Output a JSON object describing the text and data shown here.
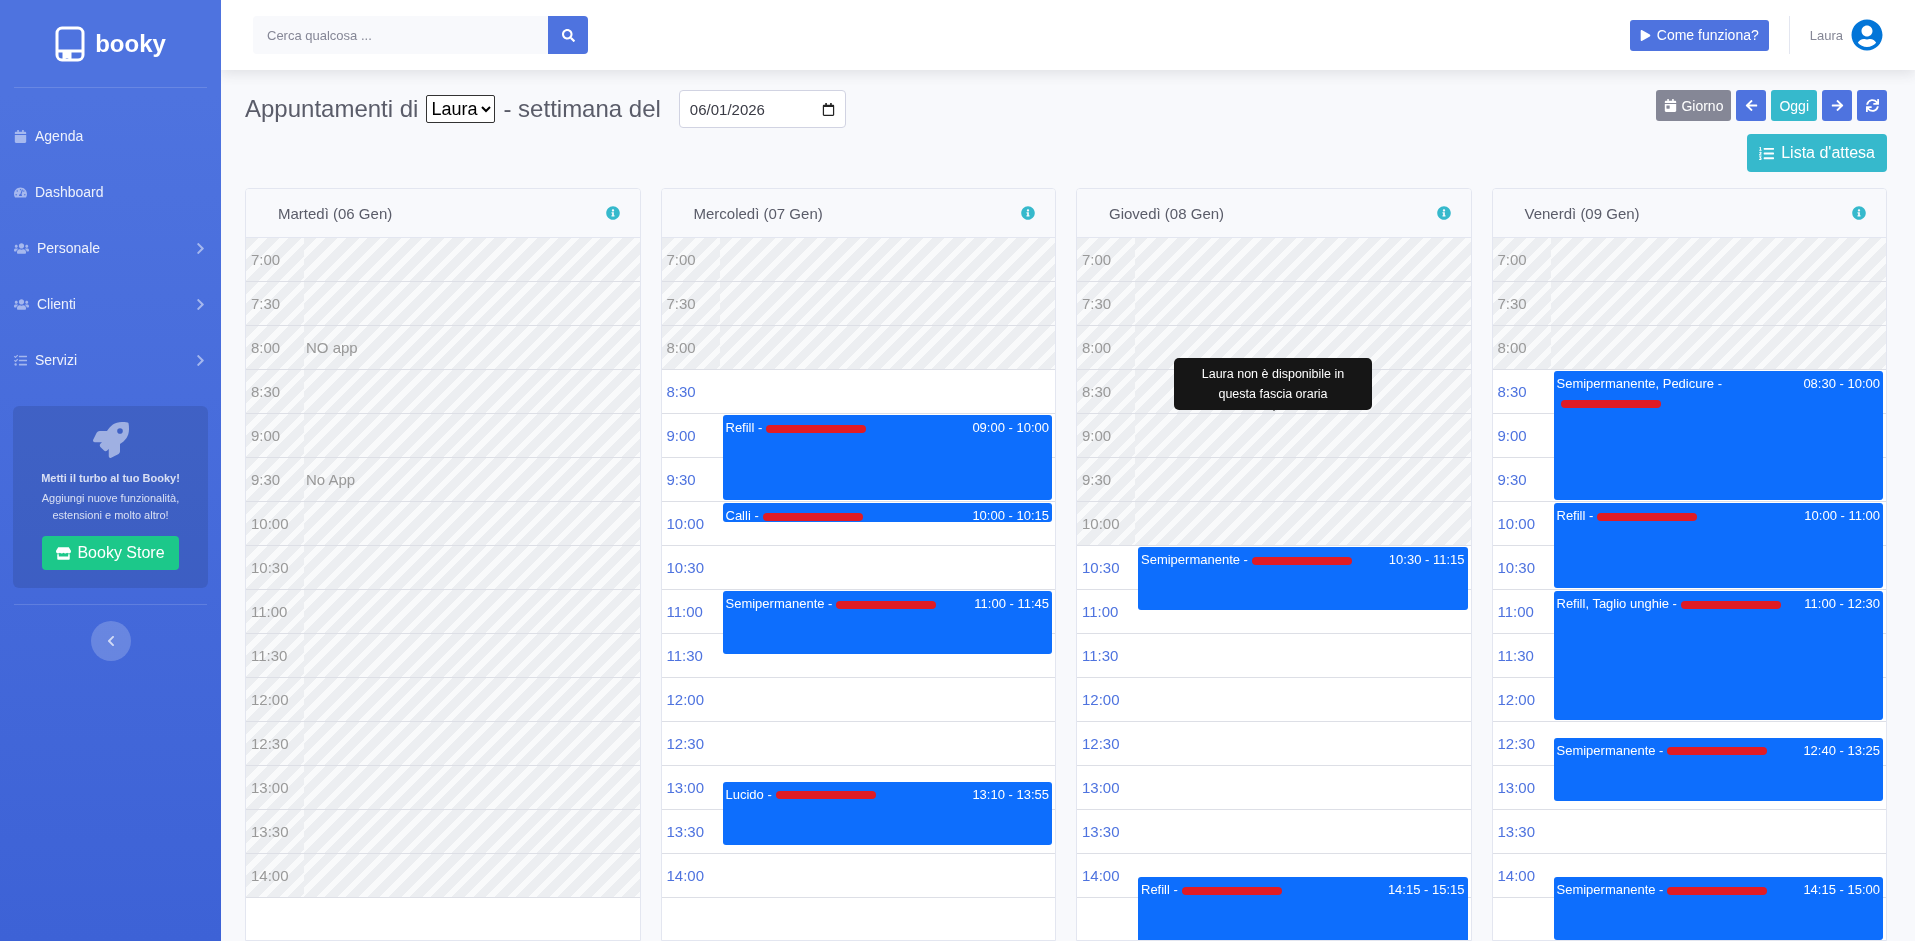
{
  "sidebar": {
    "brand": "booky",
    "items": [
      {
        "label": "Agenda",
        "submenu": false
      },
      {
        "label": "Dashboard",
        "submenu": false
      },
      {
        "label": "Personale",
        "submenu": true
      },
      {
        "label": "Clienti",
        "submenu": true
      },
      {
        "label": "Servizi",
        "submenu": true
      }
    ],
    "promo": {
      "title": "Metti il turbo al tuo Booky!",
      "text": "Aggiungi nuove funzionalità, estensioni e molto altro!",
      "button": "Booky Store"
    }
  },
  "topbar": {
    "search": {
      "placeholder": "Cerca qualcosa ..."
    },
    "help_button": "Come funziona?",
    "user": "Laura"
  },
  "toolbar": {
    "title_prefix": "Appuntamenti di",
    "staff": "Laura",
    "title_middle": "- settimana del",
    "date": "06/01/2026",
    "buttons": [
      {
        "kind": "day",
        "label": "Giorno"
      },
      {
        "kind": "prev"
      },
      {
        "kind": "today",
        "label": "Oggi"
      },
      {
        "kind": "next"
      },
      {
        "kind": "refresh"
      }
    ],
    "waitlist_button": "Lista d'attesa"
  },
  "days": [
    {
      "title": "Martedì (06 Gen)",
      "slots": [
        {
          "time": "7:00",
          "available": false
        },
        {
          "time": "7:30",
          "available": false
        },
        {
          "time": "8:00",
          "available": false,
          "note": "NO app"
        },
        {
          "time": "8:30",
          "available": false
        },
        {
          "time": "9:00",
          "available": false
        },
        {
          "time": "9:30",
          "available": false,
          "note": "No App"
        },
        {
          "time": "10:00",
          "available": false
        },
        {
          "time": "10:30",
          "available": false
        },
        {
          "time": "11:00",
          "available": false
        },
        {
          "time": "11:30",
          "available": false
        },
        {
          "time": "12:00",
          "available": false
        },
        {
          "time": "12:30",
          "available": false
        },
        {
          "time": "13:00",
          "available": false
        },
        {
          "time": "13:30",
          "available": false
        },
        {
          "time": "14:00",
          "available": false
        }
      ]
    },
    {
      "title": "Mercoledì (07 Gen)",
      "slots": [
        {
          "time": "7:00",
          "available": false
        },
        {
          "time": "7:30",
          "available": false
        },
        {
          "time": "8:00",
          "available": false
        },
        {
          "time": "8:30",
          "available": true
        },
        {
          "time": "9:00",
          "available": true
        },
        {
          "time": "9:30",
          "available": true
        },
        {
          "time": "10:00",
          "available": true
        },
        {
          "time": "10:30",
          "available": true
        },
        {
          "time": "11:00",
          "available": true
        },
        {
          "time": "11:30",
          "available": true
        },
        {
          "time": "12:00",
          "available": true
        },
        {
          "time": "12:30",
          "available": true
        },
        {
          "time": "13:00",
          "available": true
        },
        {
          "time": "13:30",
          "available": true
        },
        {
          "time": "14:00",
          "available": true
        }
      ],
      "appointments": [
        {
          "label": "Refill -",
          "time": "09:00 - 10:00"
        },
        {
          "label": "Calli -",
          "time": "10:00 - 10:15"
        },
        {
          "label": "Semipermanente -",
          "time": "11:00 - 11:45"
        },
        {
          "label": "Lucido -",
          "time": "13:10 - 13:55"
        }
      ]
    },
    {
      "title": "Giovedì (08 Gen)",
      "slots": [
        {
          "time": "7:00",
          "available": false
        },
        {
          "time": "7:30",
          "available": false
        },
        {
          "time": "8:00",
          "available": false
        },
        {
          "time": "8:30",
          "available": false,
          "tooltip": "Laura non è disponibile in questa fascia oraria"
        },
        {
          "time": "9:00",
          "available": false
        },
        {
          "time": "9:30",
          "available": false
        },
        {
          "time": "10:00",
          "available": false
        },
        {
          "time": "10:30",
          "available": true
        },
        {
          "time": "11:00",
          "available": true
        },
        {
          "time": "11:30",
          "available": true
        },
        {
          "time": "12:00",
          "available": true
        },
        {
          "time": "12:30",
          "available": true
        },
        {
          "time": "13:00",
          "available": true
        },
        {
          "time": "13:30",
          "available": true
        },
        {
          "time": "14:00",
          "available": true
        }
      ],
      "appointments": [
        {
          "label": "Semipermanente -",
          "time": "10:30 - 11:15"
        },
        {
          "label": "Refill -",
          "time": "14:15 - 15:15"
        }
      ]
    },
    {
      "title": "Venerdì (09 Gen)",
      "slots": [
        {
          "time": "7:00",
          "available": false
        },
        {
          "time": "7:30",
          "available": false
        },
        {
          "time": "8:00",
          "available": false
        },
        {
          "time": "8:30",
          "available": true
        },
        {
          "time": "9:00",
          "available": true
        },
        {
          "time": "9:30",
          "available": true
        },
        {
          "time": "10:00",
          "available": true
        },
        {
          "time": "10:30",
          "available": true
        },
        {
          "time": "11:00",
          "available": true
        },
        {
          "time": "11:30",
          "available": true
        },
        {
          "time": "12:00",
          "available": true
        },
        {
          "time": "12:30",
          "available": true
        },
        {
          "time": "13:00",
          "available": true
        },
        {
          "time": "13:30",
          "available": true
        },
        {
          "time": "14:00",
          "available": true
        }
      ],
      "appointments": [
        {
          "label": "Semipermanente, Pedicure -",
          "time": "08:30 - 10:00"
        },
        {
          "label": "Refill -",
          "time": "10:00 - 11:00"
        },
        {
          "label": "Refill, Taglio unghie -",
          "time": "11:00 - 12:30"
        },
        {
          "label": "Semipermanente -",
          "time": "12:40 - 13:25"
        },
        {
          "label": "Semipermanente -",
          "time": "14:15 - 15:00"
        }
      ]
    }
  ]
}
